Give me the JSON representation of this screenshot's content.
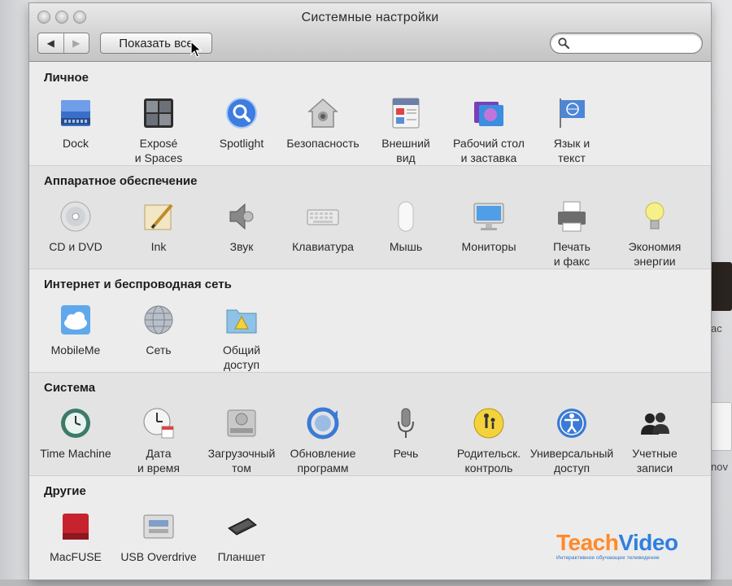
{
  "window": {
    "title": "Системные настройки",
    "back_label": "◀",
    "forward_label": "▶",
    "show_all_label": "Показать все",
    "search_placeholder": ""
  },
  "sections": [
    {
      "title": "Личное",
      "items": [
        {
          "label": "Dock",
          "icon": "dock-icon"
        },
        {
          "label": "Exposé\nи Spaces",
          "icon": "expose-spaces-icon"
        },
        {
          "label": "Spotlight",
          "icon": "spotlight-icon"
        },
        {
          "label": "Безопасность",
          "icon": "security-house-icon"
        },
        {
          "label": "Внешний\nвид",
          "icon": "appearance-icon"
        },
        {
          "label": "Рабочий стол\nи заставка",
          "icon": "desktop-screensaver-icon"
        },
        {
          "label": "Язык и\nтекст",
          "icon": "language-flag-icon"
        }
      ]
    },
    {
      "title": "Аппаратное обеспечение",
      "items": [
        {
          "label": "CD и DVD",
          "icon": "cd-dvd-icon"
        },
        {
          "label": "Ink",
          "icon": "ink-pen-icon"
        },
        {
          "label": "Звук",
          "icon": "speaker-icon"
        },
        {
          "label": "Клавиатура",
          "icon": "keyboard-icon"
        },
        {
          "label": "Мышь",
          "icon": "mouse-icon"
        },
        {
          "label": "Мониторы",
          "icon": "monitor-icon"
        },
        {
          "label": "Печать\nи факс",
          "icon": "printer-icon"
        },
        {
          "label": "Экономия\nэнергии",
          "icon": "lightbulb-icon"
        }
      ]
    },
    {
      "title": "Интернет и беспроводная сеть",
      "items": [
        {
          "label": "MobileMe",
          "icon": "mobileme-cloud-icon"
        },
        {
          "label": "Сеть",
          "icon": "network-globe-icon"
        },
        {
          "label": "Общий\nдоступ",
          "icon": "sharing-folder-icon"
        }
      ]
    },
    {
      "title": "Система",
      "items": [
        {
          "label": "Time Machine",
          "icon": "time-machine-icon"
        },
        {
          "label": "Дата\nи время",
          "icon": "clock-calendar-icon"
        },
        {
          "label": "Загрузочный\nтом",
          "icon": "startup-disk-icon"
        },
        {
          "label": "Обновление\nпрограмм",
          "icon": "software-update-icon"
        },
        {
          "label": "Речь",
          "icon": "microphone-icon"
        },
        {
          "label": "Родительск.\nконтроль",
          "icon": "parental-controls-icon"
        },
        {
          "label": "Универсальный\nдоступ",
          "icon": "accessibility-icon"
        },
        {
          "label": "Учетные\nзаписи",
          "icon": "accounts-icon"
        }
      ]
    },
    {
      "title": "Другие",
      "items": [
        {
          "label": "MacFUSE",
          "icon": "macfuse-icon"
        },
        {
          "label": "USB Overdrive",
          "icon": "usb-overdrive-icon"
        },
        {
          "label": "Планшет",
          "icon": "tablet-icon"
        }
      ]
    }
  ],
  "watermark": {
    "brand_part1": "Teach",
    "brand_part2": "Video",
    "tagline": "Интерактивное обучающее телевидение"
  },
  "desktop": {
    "edge_text_1": "ac",
    "edge_text_2": "nov"
  }
}
